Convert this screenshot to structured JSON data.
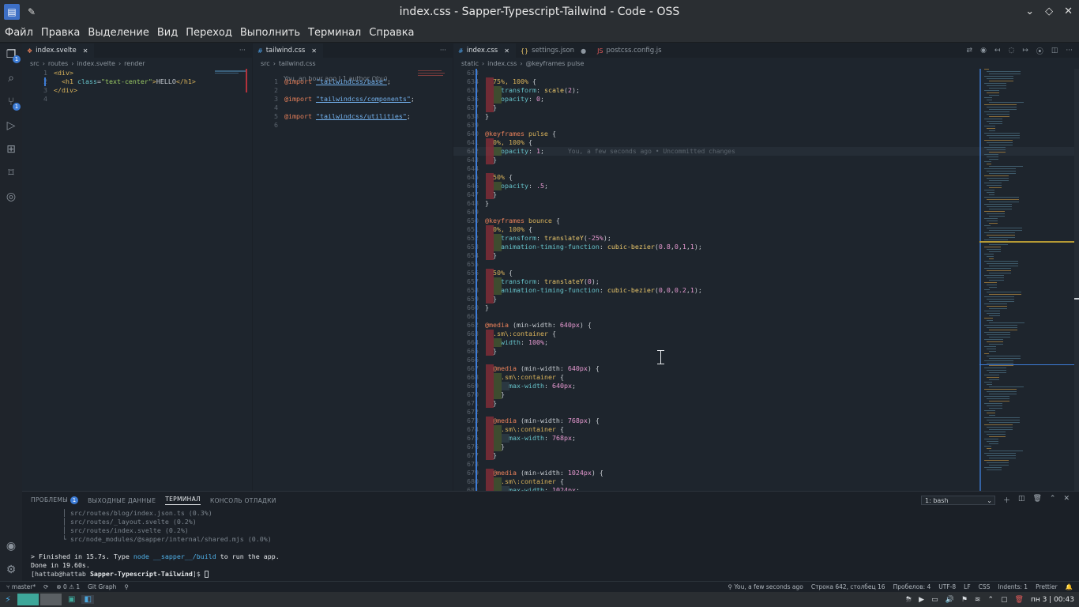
{
  "window": {
    "title": "index.css - Sapper-Typescript-Tailwind - Code - OSS",
    "controls": [
      "chevron-down",
      "diamond",
      "close"
    ]
  },
  "menu": [
    "Файл",
    "Правка",
    "Выделение",
    "Вид",
    "Переход",
    "Выполнить",
    "Терминал",
    "Справка"
  ],
  "activity": {
    "scm_badge": "1"
  },
  "group1": {
    "tab": "index.svelte",
    "breadcrumbs": [
      "src",
      "routes",
      "index.svelte",
      "render"
    ],
    "lines": [
      {
        "n": "1",
        "tokens": [
          [
            "c-tag",
            "<div>"
          ]
        ]
      },
      {
        "n": "2",
        "tokens": [
          [
            "c-plain",
            "  "
          ],
          [
            "c-tag",
            "<h1 "
          ],
          [
            "c-attr",
            "class"
          ],
          [
            "c-plain",
            "="
          ],
          [
            "c-str",
            "\"text-center\""
          ],
          [
            "c-tag",
            ">"
          ],
          [
            "c-plain",
            "HELLO"
          ],
          [
            "c-tag",
            "</h1>"
          ]
        ]
      },
      {
        "n": "3",
        "tokens": [
          [
            "c-tag",
            "</div>"
          ]
        ]
      },
      {
        "n": "4",
        "tokens": []
      }
    ]
  },
  "group2": {
    "tab": "tailwind.css",
    "breadcrumbs": [
      "src",
      "tailwind.css"
    ],
    "codelens": "You, an hour ago | 1 author (You)",
    "lines": [
      {
        "n": "1",
        "tokens": [
          [
            "c-kw",
            "@import "
          ],
          [
            "c-ref",
            "\"tailwindcss/base\""
          ],
          [
            "c-plain",
            ";"
          ]
        ]
      },
      {
        "n": "2",
        "tokens": []
      },
      {
        "n": "3",
        "tokens": [
          [
            "c-kw",
            "@import "
          ],
          [
            "c-ref",
            "\"tailwindcss/components\""
          ],
          [
            "c-plain",
            ";"
          ]
        ]
      },
      {
        "n": "4",
        "tokens": []
      },
      {
        "n": "5",
        "tokens": [
          [
            "c-kw",
            "@import "
          ],
          [
            "c-ref",
            "\"tailwindcss/utilities\""
          ],
          [
            "c-plain",
            ";"
          ]
        ]
      },
      {
        "n": "6",
        "tokens": []
      }
    ]
  },
  "group3": {
    "tabs": [
      {
        "label": "index.css",
        "active": true,
        "icon": "#",
        "dirty": false
      },
      {
        "label": "settings.json",
        "active": false,
        "icon": "{}",
        "dirty": true
      },
      {
        "label": "postcss.config.js",
        "active": false,
        "icon": "JS",
        "dirty": false
      }
    ],
    "breadcrumbs": [
      "static",
      "index.css",
      "@keyframes pulse"
    ],
    "blame": "You, a few seconds ago • Uncommitted changes",
    "lines": [
      {
        "n": "633",
        "i": 0,
        "tokens": []
      },
      {
        "n": "634",
        "i": 1,
        "tokens": [
          [
            "c-sel",
            "75%, 100% "
          ],
          [
            "c-plain",
            "{"
          ]
        ]
      },
      {
        "n": "635",
        "i": 2,
        "tokens": [
          [
            "c-prop",
            "transform"
          ],
          [
            "c-plain",
            ": "
          ],
          [
            "c-fn",
            "scale"
          ],
          [
            "c-plain",
            "("
          ],
          [
            "c-num",
            "2"
          ],
          [
            "c-plain",
            ");"
          ]
        ]
      },
      {
        "n": "636",
        "i": 2,
        "tokens": [
          [
            "c-prop",
            "opacity"
          ],
          [
            "c-plain",
            ": "
          ],
          [
            "c-num",
            "0"
          ],
          [
            "c-plain",
            ";"
          ]
        ]
      },
      {
        "n": "637",
        "i": 1,
        "tokens": [
          [
            "c-plain",
            "}"
          ]
        ]
      },
      {
        "n": "638",
        "i": 0,
        "tokens": [
          [
            "c-plain",
            "}"
          ]
        ]
      },
      {
        "n": "639",
        "i": 0,
        "tokens": []
      },
      {
        "n": "640",
        "i": 0,
        "tokens": [
          [
            "c-kw",
            "@keyframes "
          ],
          [
            "c-sel",
            "pulse "
          ],
          [
            "c-plain",
            "{"
          ]
        ]
      },
      {
        "n": "641",
        "i": 1,
        "tokens": [
          [
            "c-sel",
            "0%, 100% "
          ],
          [
            "c-plain",
            "{"
          ]
        ]
      },
      {
        "n": "642",
        "i": 2,
        "tokens": [
          [
            "c-prop",
            "opacity"
          ],
          [
            "c-plain",
            ": "
          ],
          [
            "c-num",
            "1"
          ],
          [
            "c-plain",
            ";"
          ]
        ],
        "blame": true
      },
      {
        "n": "643",
        "i": 1,
        "tokens": [
          [
            "c-plain",
            "}"
          ]
        ]
      },
      {
        "n": "644",
        "i": 0,
        "tokens": []
      },
      {
        "n": "645",
        "i": 1,
        "tokens": [
          [
            "c-sel",
            "50% "
          ],
          [
            "c-plain",
            "{"
          ]
        ]
      },
      {
        "n": "646",
        "i": 2,
        "tokens": [
          [
            "c-prop",
            "opacity"
          ],
          [
            "c-plain",
            ": "
          ],
          [
            "c-num",
            ".5"
          ],
          [
            "c-plain",
            ";"
          ]
        ]
      },
      {
        "n": "647",
        "i": 1,
        "tokens": [
          [
            "c-plain",
            "}"
          ]
        ]
      },
      {
        "n": "648",
        "i": 0,
        "tokens": [
          [
            "c-plain",
            "}"
          ]
        ]
      },
      {
        "n": "649",
        "i": 0,
        "tokens": []
      },
      {
        "n": "650",
        "i": 0,
        "tokens": [
          [
            "c-kw",
            "@keyframes "
          ],
          [
            "c-sel",
            "bounce "
          ],
          [
            "c-plain",
            "{"
          ]
        ]
      },
      {
        "n": "651",
        "i": 1,
        "tokens": [
          [
            "c-sel",
            "0%, 100% "
          ],
          [
            "c-plain",
            "{"
          ]
        ]
      },
      {
        "n": "652",
        "i": 2,
        "tokens": [
          [
            "c-prop",
            "transform"
          ],
          [
            "c-plain",
            ": "
          ],
          [
            "c-fn",
            "translateY"
          ],
          [
            "c-plain",
            "("
          ],
          [
            "c-num",
            "-25%"
          ],
          [
            "c-plain",
            ");"
          ]
        ]
      },
      {
        "n": "653",
        "i": 2,
        "tokens": [
          [
            "c-prop",
            "animation-timing-function"
          ],
          [
            "c-plain",
            ": "
          ],
          [
            "c-fn",
            "cubic-bezier"
          ],
          [
            "c-plain",
            "("
          ],
          [
            "c-num",
            "0.8"
          ],
          [
            "c-plain",
            ","
          ],
          [
            "c-num",
            "0"
          ],
          [
            "c-plain",
            ","
          ],
          [
            "c-num",
            "1"
          ],
          [
            "c-plain",
            ","
          ],
          [
            "c-num",
            "1"
          ],
          [
            "c-plain",
            ");"
          ]
        ]
      },
      {
        "n": "654",
        "i": 1,
        "tokens": [
          [
            "c-plain",
            "}"
          ]
        ]
      },
      {
        "n": "655",
        "i": 0,
        "tokens": []
      },
      {
        "n": "656",
        "i": 1,
        "tokens": [
          [
            "c-sel",
            "50% "
          ],
          [
            "c-plain",
            "{"
          ]
        ]
      },
      {
        "n": "657",
        "i": 2,
        "tokens": [
          [
            "c-prop",
            "transform"
          ],
          [
            "c-plain",
            ": "
          ],
          [
            "c-fn",
            "translateY"
          ],
          [
            "c-plain",
            "("
          ],
          [
            "c-num",
            "0"
          ],
          [
            "c-plain",
            ");"
          ]
        ]
      },
      {
        "n": "658",
        "i": 2,
        "tokens": [
          [
            "c-prop",
            "animation-timing-function"
          ],
          [
            "c-plain",
            ": "
          ],
          [
            "c-fn",
            "cubic-bezier"
          ],
          [
            "c-plain",
            "("
          ],
          [
            "c-num",
            "0"
          ],
          [
            "c-plain",
            ","
          ],
          [
            "c-num",
            "0"
          ],
          [
            "c-plain",
            ","
          ],
          [
            "c-num",
            "0.2"
          ],
          [
            "c-plain",
            ","
          ],
          [
            "c-num",
            "1"
          ],
          [
            "c-plain",
            ");"
          ]
        ]
      },
      {
        "n": "659",
        "i": 1,
        "tokens": [
          [
            "c-plain",
            "}"
          ]
        ]
      },
      {
        "n": "660",
        "i": 0,
        "tokens": [
          [
            "c-plain",
            "}"
          ]
        ]
      },
      {
        "n": "661",
        "i": 0,
        "tokens": []
      },
      {
        "n": "662",
        "i": 0,
        "tokens": [
          [
            "c-kw",
            "@media "
          ],
          [
            "c-plain",
            "(min-width: "
          ],
          [
            "c-num",
            "640px"
          ],
          [
            "c-plain",
            ") {"
          ]
        ]
      },
      {
        "n": "663",
        "i": 1,
        "tokens": [
          [
            "c-sel",
            ".sm\\:container "
          ],
          [
            "c-plain",
            "{"
          ]
        ]
      },
      {
        "n": "664",
        "i": 2,
        "tokens": [
          [
            "c-prop",
            "width"
          ],
          [
            "c-plain",
            ": "
          ],
          [
            "c-num",
            "100%"
          ],
          [
            "c-plain",
            ";"
          ]
        ]
      },
      {
        "n": "665",
        "i": 1,
        "tokens": [
          [
            "c-plain",
            "}"
          ]
        ]
      },
      {
        "n": "666",
        "i": 0,
        "tokens": []
      },
      {
        "n": "667",
        "i": 1,
        "tokens": [
          [
            "c-kw",
            "@media "
          ],
          [
            "c-plain",
            "(min-width: "
          ],
          [
            "c-num",
            "640px"
          ],
          [
            "c-plain",
            ") {"
          ]
        ]
      },
      {
        "n": "668",
        "i": 2,
        "tokens": [
          [
            "c-sel",
            ".sm\\:container "
          ],
          [
            "c-plain",
            "{"
          ]
        ]
      },
      {
        "n": "669",
        "i": 3,
        "tokens": [
          [
            "c-prop",
            "max-width"
          ],
          [
            "c-plain",
            ": "
          ],
          [
            "c-num",
            "640px"
          ],
          [
            "c-plain",
            ";"
          ]
        ]
      },
      {
        "n": "670",
        "i": 2,
        "tokens": [
          [
            "c-plain",
            "}"
          ]
        ]
      },
      {
        "n": "671",
        "i": 1,
        "tokens": [
          [
            "c-plain",
            "}"
          ]
        ]
      },
      {
        "n": "672",
        "i": 0,
        "tokens": []
      },
      {
        "n": "673",
        "i": 1,
        "tokens": [
          [
            "c-kw",
            "@media "
          ],
          [
            "c-plain",
            "(min-width: "
          ],
          [
            "c-num",
            "768px"
          ],
          [
            "c-plain",
            ") {"
          ]
        ]
      },
      {
        "n": "674",
        "i": 2,
        "tokens": [
          [
            "c-sel",
            ".sm\\:container "
          ],
          [
            "c-plain",
            "{"
          ]
        ]
      },
      {
        "n": "675",
        "i": 3,
        "tokens": [
          [
            "c-prop",
            "max-width"
          ],
          [
            "c-plain",
            ": "
          ],
          [
            "c-num",
            "768px"
          ],
          [
            "c-plain",
            ";"
          ]
        ]
      },
      {
        "n": "676",
        "i": 2,
        "tokens": [
          [
            "c-plain",
            "}"
          ]
        ]
      },
      {
        "n": "677",
        "i": 1,
        "tokens": [
          [
            "c-plain",
            "}"
          ]
        ]
      },
      {
        "n": "678",
        "i": 0,
        "tokens": []
      },
      {
        "n": "679",
        "i": 1,
        "tokens": [
          [
            "c-kw",
            "@media "
          ],
          [
            "c-plain",
            "(min-width: "
          ],
          [
            "c-num",
            "1024px"
          ],
          [
            "c-plain",
            ") {"
          ]
        ]
      },
      {
        "n": "680",
        "i": 2,
        "tokens": [
          [
            "c-sel",
            ".sm\\:container "
          ],
          [
            "c-plain",
            "{"
          ]
        ]
      },
      {
        "n": "681",
        "i": 3,
        "tokens": [
          [
            "c-prop",
            "max-width"
          ],
          [
            "c-plain",
            ": "
          ],
          [
            "c-num",
            "1024px"
          ],
          [
            "c-plain",
            ";"
          ]
        ]
      }
    ]
  },
  "panel": {
    "tabs": [
      {
        "label": "ПРОБЛЕМЫ",
        "badge": "1",
        "active": false
      },
      {
        "label": "ВЫХОДНЫЕ ДАННЫЕ",
        "active": false
      },
      {
        "label": "ТЕРМИНАЛ",
        "active": true
      },
      {
        "label": "КОНСОЛЬ ОТЛАДКИ",
        "active": false
      }
    ],
    "terminal_select": "1: bash",
    "terminal": [
      {
        "text": "        │ src/routes/blog/index.json.ts (0.3%)",
        "cls": "dim"
      },
      {
        "text": "        │ src/routes/_layout.svelte (0.2%)",
        "cls": "dim"
      },
      {
        "text": "        │ src/routes/index.svelte (0.2%)",
        "cls": "dim"
      },
      {
        "text": "        └ src/node_modules/@sapper/internal/shared.mjs (0.0%)",
        "cls": "dim"
      },
      {
        "text": "",
        "cls": ""
      },
      {
        "pre": "> Finished in 15.7s. Type ",
        "hl": "node __sapper__/build",
        "post": " to run the app.",
        "cls": "fin"
      },
      {
        "text": "Done in 19.60s.",
        "cls": ""
      },
      {
        "prompt": "[hattab@hattab ",
        "dir": "Sapper-Typescript-Tailwind",
        "end": "]$ ",
        "cls": "prompt"
      }
    ]
  },
  "status": {
    "branch": "master*",
    "sync": "⟳",
    "problems": "⊗ 0 ⚠ 1",
    "gitgraph": "Git Graph",
    "blame": "You, a few seconds ago",
    "position": "Строка 642, столбец 16",
    "spaces": "Пробелов: 4",
    "encoding": "UTF-8",
    "eol": "LF",
    "language": "CSS",
    "indents": "Indents: 1",
    "formatter": "Prettier"
  },
  "taskbar": {
    "clock": "пн 3 | 00:43"
  },
  "colors": {
    "accent": "#3d7cd6",
    "editor_bg": "#1e252d",
    "diff_red": "#b4323c",
    "diff_green": "#5a6e32"
  }
}
